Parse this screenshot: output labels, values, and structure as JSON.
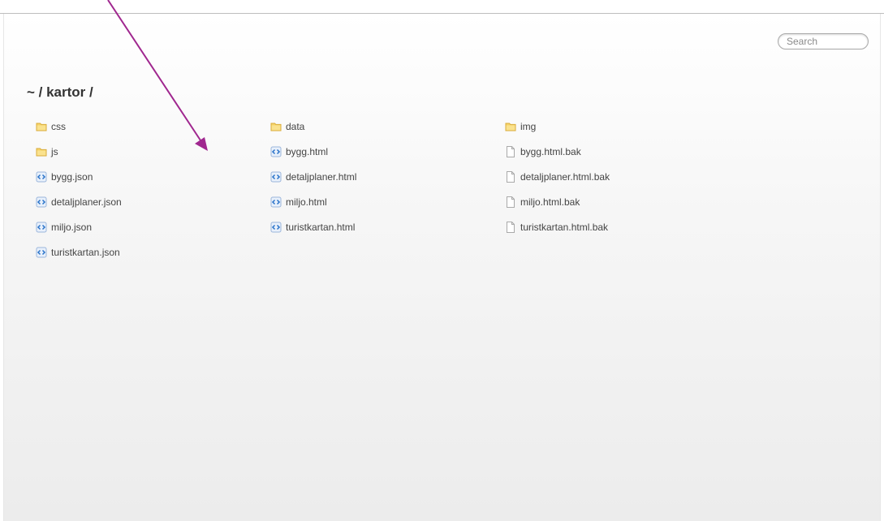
{
  "search": {
    "placeholder": "Search"
  },
  "breadcrumb": "~ / kartor /",
  "files": [
    {
      "name": "css",
      "type": "folder"
    },
    {
      "name": "data",
      "type": "folder"
    },
    {
      "name": "img",
      "type": "folder"
    },
    {
      "name": "js",
      "type": "folder"
    },
    {
      "name": "bygg.html",
      "type": "code"
    },
    {
      "name": "bygg.html.bak",
      "type": "file"
    },
    {
      "name": "bygg.json",
      "type": "code"
    },
    {
      "name": "detaljplaner.html",
      "type": "code"
    },
    {
      "name": "detaljplaner.html.bak",
      "type": "file"
    },
    {
      "name": "detaljplaner.json",
      "type": "code"
    },
    {
      "name": "miljo.html",
      "type": "code"
    },
    {
      "name": "miljo.html.bak",
      "type": "file"
    },
    {
      "name": "miljo.json",
      "type": "code"
    },
    {
      "name": "turistkartan.html",
      "type": "code"
    },
    {
      "name": "turistkartan.html.bak",
      "type": "file"
    },
    {
      "name": "turistkartan.json",
      "type": "code"
    }
  ],
  "colors": {
    "annotation_arrow": "#a0278f",
    "folder_icon": "#f5d469",
    "code_icon": "#2a73c9"
  }
}
